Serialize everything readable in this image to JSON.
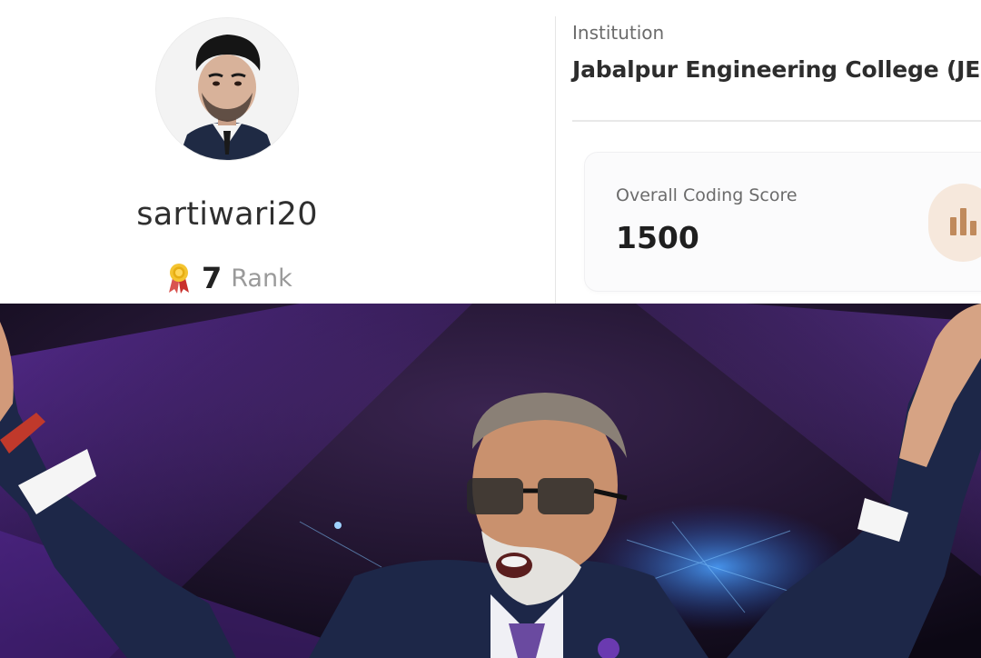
{
  "profile": {
    "username": "sartiwari20",
    "rank_value": "7",
    "rank_label": "Rank",
    "avatar_icon": "profile-photo-avatar",
    "rank_icon": "medal-icon"
  },
  "institution": {
    "label": "Institution",
    "name": "Jabalpur Engineering College (JEC)"
  },
  "score": {
    "label": "Overall Coding Score",
    "value": "1500",
    "icon": "bar-chart-icon"
  },
  "photo": {
    "description_icon": "celebrating-host-photo"
  },
  "colors": {
    "badge_bg": "#f6e8dc",
    "badge_fg": "#c08a5c",
    "stage_purple": "#5a2a9a",
    "stage_blue": "#2a6cd8",
    "suit": "#1d2748"
  }
}
